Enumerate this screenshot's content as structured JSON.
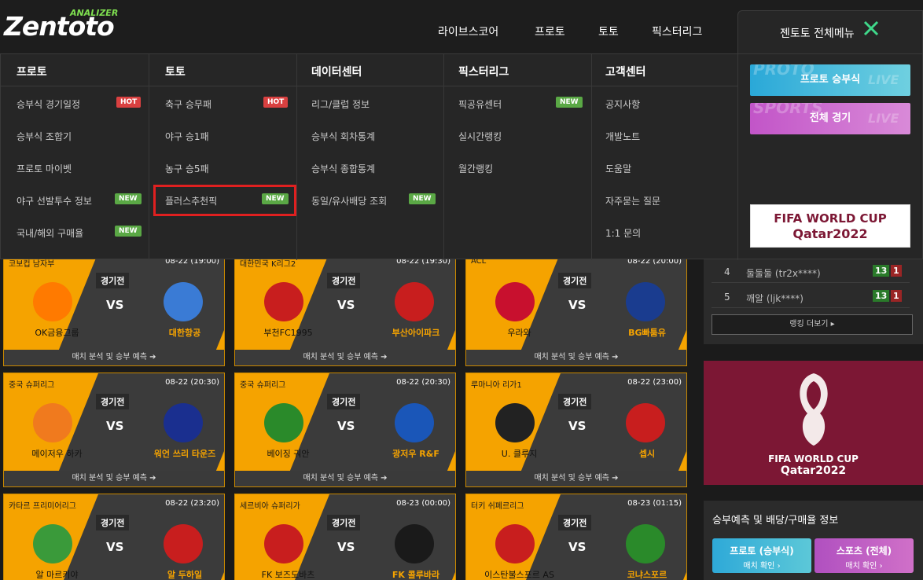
{
  "logo": {
    "main": "Zentoto",
    "sub": "ANALIZER"
  },
  "topnav": [
    "라이브스코어",
    "프로토",
    "토토",
    "픽스터리그"
  ],
  "fullmenu": {
    "label": "젠토토 전체메뉴"
  },
  "menu": {
    "proto": {
      "title": "프로토",
      "items": [
        "승부식 경기일정",
        "승부식 조합기",
        "프로토 마이벳",
        "야구 선발투수 정보",
        "국내/해외 구매율"
      ],
      "badges": [
        "HOT",
        "",
        "",
        "NEW",
        "NEW"
      ]
    },
    "toto": {
      "title": "토토",
      "items": [
        "축구 승무패",
        "야구 승1패",
        "농구 승5패",
        "플러스추천픽"
      ],
      "badges": [
        "HOT",
        "",
        "",
        "NEW"
      ]
    },
    "data": {
      "title": "데이터센터",
      "items": [
        "리그/클럽 정보",
        "승부식 회차통계",
        "승부식 종합통계",
        "동일/유사배당 조회"
      ],
      "badges": [
        "",
        "",
        "",
        "NEW"
      ]
    },
    "pick": {
      "title": "픽스터리그",
      "items": [
        "픽공유센터",
        "실시간랭킹",
        "월간랭킹"
      ],
      "badges": [
        "NEW",
        "",
        ""
      ]
    },
    "cs": {
      "title": "고객센터",
      "items": [
        "공지사항",
        "개발노트",
        "도움말",
        "자주묻는 질문",
        "1:1 문의"
      ]
    }
  },
  "promos": {
    "proto": {
      "label": "프로토 승부식",
      "ghost1": "PROTO",
      "ghost2": "LIVE"
    },
    "sports": {
      "label": "전체 경기",
      "ghost1": "SPORTS",
      "ghost2": "LIVE"
    },
    "worldcup": {
      "line1": "FIFA WORLD CUP",
      "line2": "Qatar2022"
    }
  },
  "matches": [
    {
      "league": "코보컵 남자부",
      "time": "08-22 (19:00)",
      "status": "경기전",
      "home": "OK금융그룹",
      "away": "대한항공",
      "footer": "매치 분석 및 승부 예측 ➔"
    },
    {
      "league": "대한민국 K리그2",
      "time": "08-22 (19:30)",
      "status": "경기전",
      "home": "부천FC1995",
      "away": "부산아이파크",
      "footer": "매치 분석 및 승부 예측 ➔"
    },
    {
      "league": "ACL",
      "time": "08-22 (20:00)",
      "status": "경기전",
      "home": "우라와",
      "away": "BG빠툼유",
      "footer": "매치 분석 및 승부 예측 ➔"
    },
    {
      "league": "중국 슈퍼리그",
      "time": "08-22 (20:30)",
      "status": "경기전",
      "home": "메이저우 하카",
      "away": "워언 쓰리 타운즈",
      "footer": "매치 분석 및 승부 예측 ➔"
    },
    {
      "league": "중국 슈퍼리그",
      "time": "08-22 (20:30)",
      "status": "경기전",
      "home": "베이징 궈안",
      "away": "광저우 R&F",
      "footer": "매치 분석 및 승부 예측 ➔"
    },
    {
      "league": "루마니아 리가1",
      "time": "08-22 (23:00)",
      "status": "경기전",
      "home": "U. 클루지",
      "away": "셉시",
      "footer": "매치 분석 및 승부 예측 ➔"
    },
    {
      "league": "카타르 프리미어리그",
      "time": "08-22 (23:20)",
      "status": "경기전",
      "home": "알 마르키야",
      "away": "알 두하일",
      "footer": ""
    },
    {
      "league": "세르비아 슈퍼리가",
      "time": "08-23 (00:00)",
      "status": "경기전",
      "home": "FK 보즈도바츠",
      "away": "FK 콜루바라",
      "footer": ""
    },
    {
      "league": "터키 쉬페르리그",
      "time": "08-23 (01:15)",
      "status": "경기전",
      "home": "이스탄불스포르 AS",
      "away": "코냐스포르",
      "footer": ""
    }
  ],
  "ranking": {
    "rows": [
      {
        "rank": "4",
        "name": "둘둘둘 (tr2x****)",
        "w": "13",
        "l": "1"
      },
      {
        "rank": "5",
        "name": "깨알 (ljk****)",
        "w": "13",
        "l": "1"
      }
    ],
    "more": "랭킹 더보기 ▸"
  },
  "wc_banner": {
    "line1": "FIFA WORLD CUP",
    "line2": "Qatar2022"
  },
  "info": {
    "title": "승부예측 및 배당/구매율 정보",
    "btn1": {
      "a": "프로토 (승부식)",
      "b": "매치 확인 ›"
    },
    "btn2": {
      "a": "스포츠 (전체)",
      "b": "매치 확인 ›"
    }
  },
  "colors": {
    "accent": "#f5a300",
    "hot": "#d94040",
    "new": "#5aa845",
    "highlight": "#e02020"
  }
}
